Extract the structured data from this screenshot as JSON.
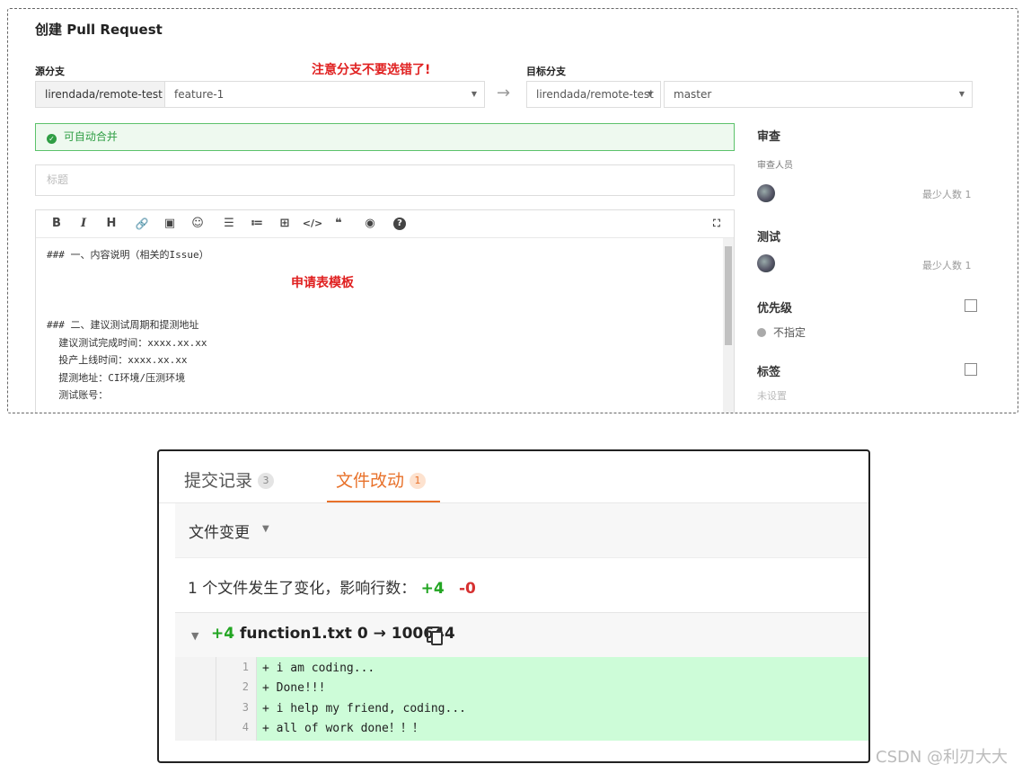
{
  "pr": {
    "title": "创建 Pull Request",
    "source_label": "源分支",
    "warning": "注意分支不要选错了!",
    "target_label": "目标分支",
    "source_repo": "lirendada/remote-test",
    "source_branch": "feature-1",
    "arrow": "→",
    "target_repo": "lirendada/remote-test",
    "target_branch": "master",
    "mergeable": "可自动合并",
    "title_placeholder": "标题",
    "editor_body": "### 一、内容说明（相关的Issue）\n\n\n\n### 二、建议测试周期和提测地址\n  建议测试完成时间：xxxx.xx.xx\n  投产上线时间：xxxx.xx.xx\n  提测地址：CI环境/压测环境\n  测试账号：",
    "template_note": "申请表模板",
    "toolbar": [
      "B",
      "I",
      "H",
      "🔗",
      "▣",
      "☺",
      "☰",
      "≔",
      "⊞",
      "</>",
      "❝",
      "◉",
      "?"
    ],
    "side": {
      "review_head": "审查",
      "reviewers_label": "审查人员",
      "review_min": "最少人数 1",
      "test_head": "测试",
      "test_min": "最少人数 1",
      "priority_head": "优先级",
      "priority_value": "不指定",
      "tags_head": "标签",
      "tags_value": "未设置"
    }
  },
  "files": {
    "tab_commits": "提交记录",
    "tab_commits_count": "3",
    "tab_files": "文件改动",
    "tab_files_count": "1",
    "change_title": "文件变更",
    "summary": "1 个文件发生了变化，影响行数：",
    "summary_add": "+4",
    "summary_del": "-0",
    "file_add": "+4",
    "file_name": "function1.txt 0 → 100644",
    "lines": [
      {
        "num": "1",
        "text": "+ i am coding..."
      },
      {
        "num": "2",
        "text": "+ Done!!!"
      },
      {
        "num": "3",
        "text": "+ i help my friend, coding..."
      },
      {
        "num": "4",
        "text": "+ all of work done！！！"
      }
    ]
  },
  "watermark": "CSDN @利刃大大"
}
